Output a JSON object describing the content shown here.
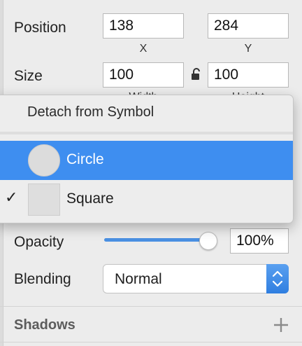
{
  "inspector": {
    "position": {
      "label": "Position",
      "x_value": "138",
      "y_value": "284",
      "x_caption": "X",
      "y_caption": "Y"
    },
    "size": {
      "label": "Size",
      "width_value": "100",
      "height_value": "100",
      "width_caption": "Width",
      "height_caption": "Height"
    },
    "opacity": {
      "label": "Opacity",
      "value": "100%",
      "level": 1.0
    },
    "blending": {
      "label": "Blending",
      "value": "Normal"
    },
    "shadows": {
      "title": "Shadows"
    }
  },
  "symbol_menu": {
    "header": "Detach from Symbol",
    "items": [
      {
        "label": "Circle",
        "thumbnail": "circle",
        "selected": true,
        "checked": false
      },
      {
        "label": "Square",
        "thumbnail": "square",
        "selected": false,
        "checked": true
      }
    ],
    "check_glyph": "✓"
  },
  "icons": {
    "lock": "lock-open-icon",
    "stepper": "up-down-chevron-icon",
    "add": "plus-icon"
  },
  "colors": {
    "accent": "#3e8ef0",
    "slider": "#4a90e2"
  }
}
